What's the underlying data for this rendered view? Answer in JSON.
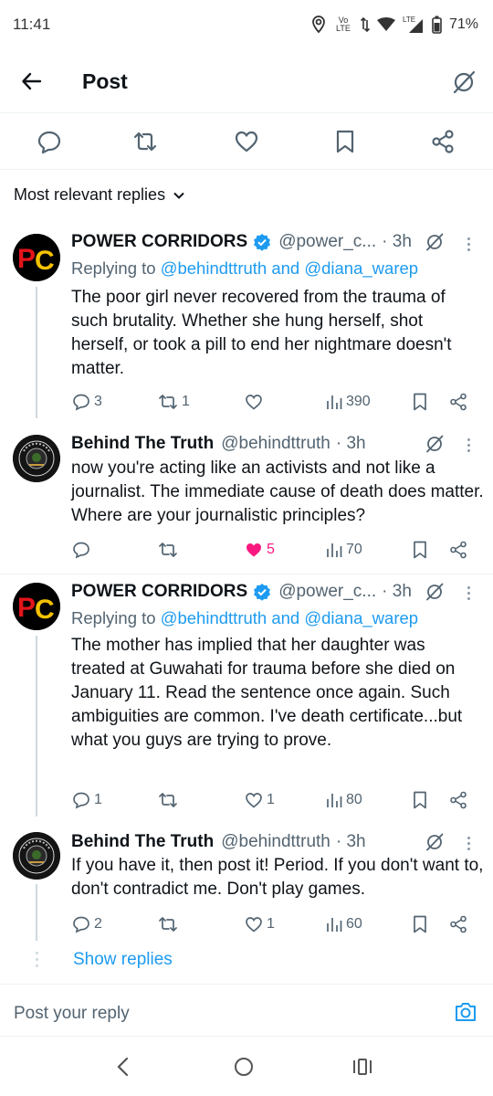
{
  "status_bar": {
    "time": "11:41",
    "volte_label": "Vo LTE",
    "lte_label": "LTE",
    "battery": "71%"
  },
  "header": {
    "title": "Post",
    "back_icon": "arrow-left-icon",
    "grok_icon": "grok-icon"
  },
  "action_bar": {
    "icons": [
      "reply-icon",
      "retweet-icon",
      "like-icon",
      "bookmark-icon",
      "share-icon"
    ]
  },
  "sort": {
    "label": "Most relevant replies"
  },
  "replies": [
    {
      "name": "POWER CORRIDORS",
      "verified": true,
      "handle": "@power_c...",
      "time": "· 3h",
      "replying_prefix": "Replying to",
      "replying_to": "@behindttruth and @diana_warep",
      "text": "The poor girl never recovered from the trauma of such brutality. Whether she hung herself, shot herself, or took a pill to end her nightmare doesn't matter.",
      "stats": {
        "replies": "3",
        "reposts": "1",
        "likes": "",
        "views": "390"
      }
    },
    {
      "name": "Behind The Truth",
      "verified": false,
      "handle": "@behindttruth",
      "time": "· 3h",
      "text": "now you're acting like an activists and not like a journalist. The immediate cause of death does matter. Where are your journalistic principles?",
      "stats": {
        "replies": "",
        "reposts": "",
        "likes": "5",
        "views": "70"
      },
      "liked": true
    },
    {
      "name": "POWER CORRIDORS",
      "verified": true,
      "handle": "@power_c...",
      "time": "· 3h",
      "replying_prefix": "Replying to",
      "replying_to": "@behindttruth and @diana_warep",
      "text": "The mother has implied that her daughter was treated at Guwahati for trauma before she died on January 11. Read the sentence once again. Such ambiguities are common. I've death certificate...but what you guys are trying to prove.",
      "stats": {
        "replies": "1",
        "reposts": "",
        "likes": "1",
        "views": "80"
      }
    },
    {
      "name": "Behind The Truth",
      "verified": false,
      "handle": "@behindttruth",
      "time": "· 3h",
      "text": "If you have it, then post it! Period. If you don't want to, don't contradict me. Don't play games.",
      "stats": {
        "replies": "2",
        "reposts": "",
        "likes": "1",
        "views": "60"
      }
    }
  ],
  "show_replies": "Show replies",
  "reply_composer": {
    "placeholder": "Post your reply",
    "camera_icon": "camera-icon"
  },
  "avatars": {
    "pc_letters": "PC",
    "bt_text": "BEHIND THE TRUTH"
  },
  "colors": {
    "accent": "#1d9bf0",
    "like": "#f91880",
    "pc_avatar_red": "#e3141b",
    "pc_avatar_yellow": "#f6c200"
  }
}
